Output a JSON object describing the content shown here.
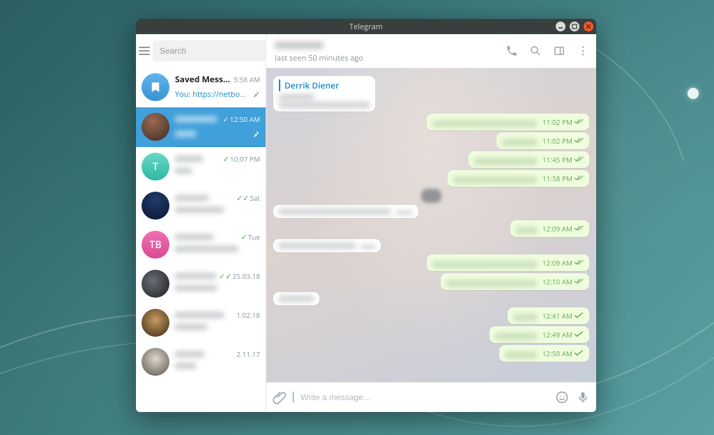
{
  "window": {
    "title": "Telegram"
  },
  "sidebar": {
    "search_placeholder": "Search",
    "items": [
      {
        "name": "Saved Messages",
        "time": "5:58 AM",
        "preview": "https://netboot.xyz...",
        "you_prefix": "You:",
        "pinned": true,
        "read": false,
        "avatar": "saved"
      },
      {
        "name": "",
        "time": "12:50 AM",
        "preview": "",
        "pinned": true,
        "read": true,
        "doubleTick": false,
        "selected": true
      },
      {
        "name": "",
        "time": "10:07 PM",
        "preview": "",
        "read": true,
        "avatar_initial": "T"
      },
      {
        "name": "",
        "time": "Sat",
        "preview": "",
        "read": true,
        "doubleTick": true
      },
      {
        "name": "",
        "time": "Tue",
        "preview": "",
        "read": true,
        "avatar_initial": "TB"
      },
      {
        "name": "",
        "time": "25.03.18",
        "preview": "",
        "read": true,
        "doubleTick": true
      },
      {
        "name": "",
        "time": "1.02.18",
        "preview": ""
      },
      {
        "name": "",
        "time": "2.11.17",
        "preview": ""
      }
    ]
  },
  "chat": {
    "header": {
      "name_blurred": true,
      "status": "last seen 50 minutes ago"
    },
    "forwarded_from": "Derrik Diener",
    "composer_placeholder": "Write a message...",
    "messages": [
      {
        "dir": "in",
        "forwarded": true,
        "time_blurred": true
      },
      {
        "dir": "out",
        "time": "11:02 PM",
        "sent": true,
        "read": true
      },
      {
        "dir": "out",
        "time": "11:02 PM",
        "sent": true,
        "read": true
      },
      {
        "dir": "out",
        "time": "11:45 PM",
        "sent": true,
        "read": true
      },
      {
        "dir": "out",
        "time": "11:58 PM",
        "sent": true,
        "read": true
      },
      {
        "dir": "center_date"
      },
      {
        "dir": "in"
      },
      {
        "dir": "out",
        "time": "12:09 AM",
        "sent": true,
        "read": true
      },
      {
        "dir": "in"
      },
      {
        "dir": "out",
        "time": "12:09 AM",
        "sent": true,
        "read": true
      },
      {
        "dir": "out",
        "time": "12:10 AM",
        "sent": true,
        "read": true
      },
      {
        "dir": "out",
        "time": "12:41 AM",
        "sent": true,
        "read": false
      },
      {
        "dir": "out",
        "time": "12:49 AM",
        "sent": true,
        "read": false
      },
      {
        "dir": "out",
        "time": "12:50 AM",
        "sent": true,
        "read": false
      }
    ]
  }
}
